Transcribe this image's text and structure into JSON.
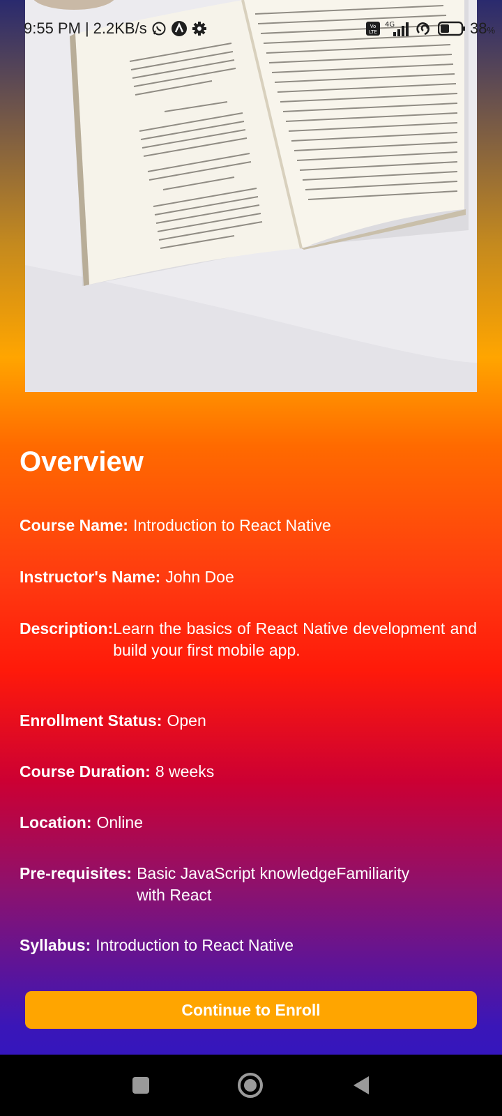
{
  "status_bar": {
    "time": "9:55 PM",
    "separator": "|",
    "speed": "2.2KB/s",
    "battery_value": "38",
    "battery_unit": "%",
    "network": "4G",
    "volte": "Vo LTE",
    "icons": [
      "whatsapp-icon",
      "app-a-icon",
      "gear-icon",
      "volte-icon",
      "signal-icon",
      "sync-icon",
      "battery-icon"
    ]
  },
  "overview": {
    "title": "Overview"
  },
  "details": {
    "course_name": {
      "label": "Course Name:",
      "value": "Introduction to React Native"
    },
    "instructor": {
      "label": "Instructor's Name:",
      "value": "John Doe"
    },
    "description": {
      "label": "Description:",
      "value": "Learn the basics of React Native development and build your first mobile app."
    },
    "enrollment": {
      "label": "Enrollment Status:",
      "value": "Open"
    },
    "duration": {
      "label": "Course Duration:",
      "value": "8 weeks"
    },
    "location": {
      "label": "Location:",
      "value": "Online"
    },
    "prerequisites": {
      "label": "Pre-requisites:",
      "value": "Basic JavaScript knowledgeFamiliarity with React"
    },
    "syllabus": {
      "label": "Syllabus:",
      "value": "Introduction to React Native"
    }
  },
  "enroll_button": {
    "label": "Continue to Enroll"
  },
  "nav_bar": {
    "icons": [
      "recents-square-icon",
      "home-circle-icon",
      "back-triangle-icon"
    ]
  },
  "colors": {
    "button": "#ffa500",
    "text": "#ffffff",
    "nav_bar": "#000000"
  }
}
